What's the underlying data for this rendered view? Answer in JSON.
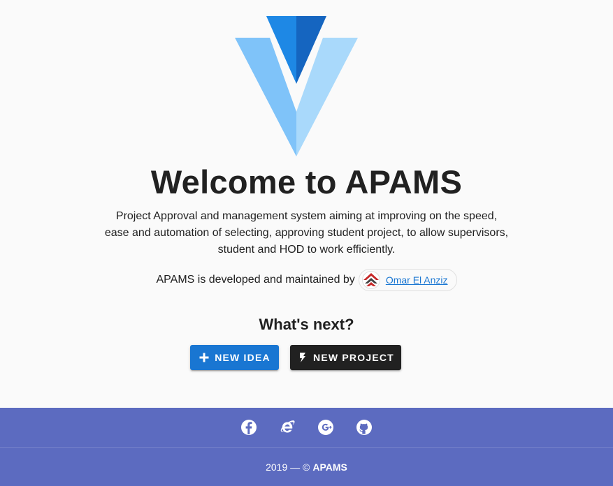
{
  "hero": {
    "title": "Welcome to APAMS",
    "description_lines": [
      "Project Approval and management system aiming at improving on the speed,",
      "ease and automation of selecting, approving student project, to allow supervisors,",
      "student and HOD to work efficiently."
    ],
    "credit_text": "APAMS is developed and maintained by",
    "author_name": "Omar El Anziz",
    "logo_icon": "vuetify-logo-icon",
    "avatar_icon": "author-logo-icon"
  },
  "next": {
    "heading": "What's next?",
    "buttons": [
      {
        "label": "New Idea",
        "icon": "plus-icon",
        "color": "#1976d2"
      },
      {
        "label": "New Project",
        "icon": "flash-icon",
        "color": "#212121"
      }
    ]
  },
  "footer": {
    "icons": [
      "facebook-icon",
      "internet-explorer-icon",
      "google-icon",
      "github-icon"
    ],
    "year": "2019",
    "separator": "—",
    "copyright_symbol": "©",
    "brand": "APAMS",
    "color": "#5c6bc0"
  }
}
